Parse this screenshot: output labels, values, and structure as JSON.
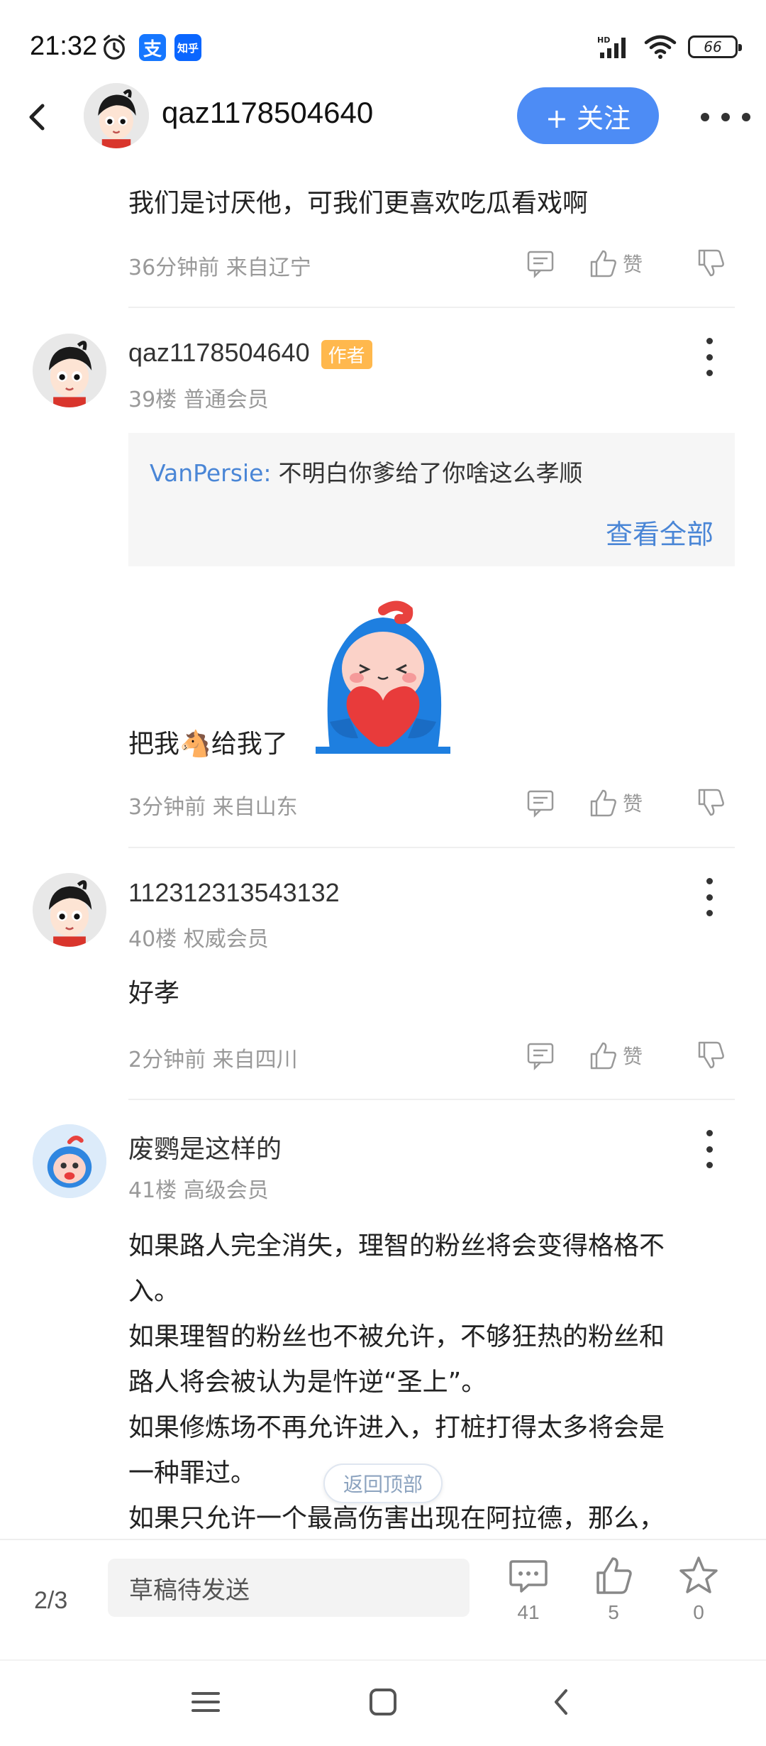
{
  "status_bar": {
    "time": "21:32",
    "alipay_label": "支",
    "zhihu_label": "知乎",
    "battery": "66"
  },
  "header": {
    "username": "qaz1178504640",
    "follow_label": "+ 关注"
  },
  "posts": [
    {
      "text": "我们是讨厌他，可我们更喜欢吃瓜看戏啊",
      "meta": "36分钟前 来自辽宁",
      "like_label": "赞"
    },
    {
      "user": "qaz1178504640",
      "author_badge": "作者",
      "floor": "39楼 普通会员",
      "quote_user": "VanPersie:",
      "quote_text": "不明白你爹给了你啥这么孝顺",
      "quote_more": "查看全部",
      "text_before": "把我",
      "emoji": "🐴",
      "text_after": "给我了",
      "meta": "3分钟前 来自山东",
      "like_label": "赞"
    },
    {
      "user": "112312313543132",
      "floor": "40楼 权威会员",
      "text": "好孝",
      "meta": "2分钟前 来自四川",
      "like_label": "赞"
    },
    {
      "user": "废鹦是这样的",
      "floor": "41楼 高级会员",
      "lines": [
        "如果路人完全消失，理智的粉丝将会变得格格不",
        "入。",
        "如果理智的粉丝也不被允许，不够狂热的粉丝和",
        "路人将会被认为是忤逆“圣上”。",
        "如果修炼场不再允许进入，打桩打得太多将会是",
        "一种罪过。",
        "如果只允许一个最高伤害出现在阿拉德，那么，"
      ]
    }
  ],
  "back_to_top": "返回顶部",
  "bottom_bar": {
    "page": "2/3",
    "draft_placeholder": "草稿待发送",
    "comments_count": "41",
    "likes_count": "5",
    "favorites_count": "0"
  }
}
